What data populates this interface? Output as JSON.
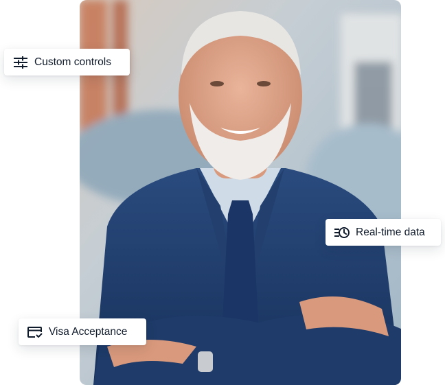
{
  "badges": {
    "custom_controls": {
      "label": "Custom controls",
      "icon": "sliders-icon"
    },
    "realtime_data": {
      "label": "Real-time data",
      "icon": "history-icon"
    },
    "visa_acceptance": {
      "label": "Visa Acceptance",
      "icon": "card-check-icon"
    }
  },
  "colors": {
    "badge_text": "#0f1a2b",
    "badge_bg": "#ffffff",
    "suit": "#1d3a66",
    "background_blur": "#b7c5cf"
  }
}
